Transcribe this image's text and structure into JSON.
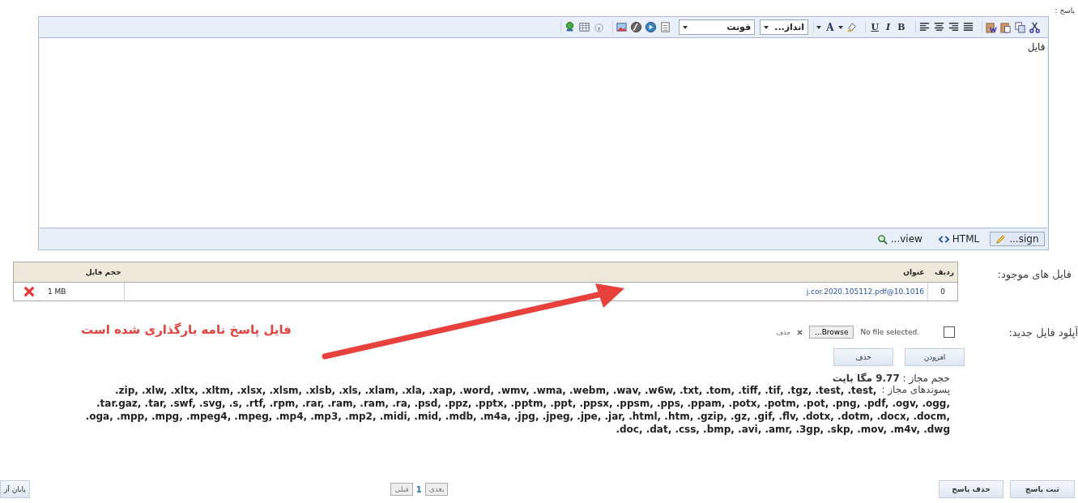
{
  "answer_label": "پاسخ :",
  "editor": {
    "format_buttons": [
      "B",
      "I",
      "U"
    ],
    "font_color_letter": "A",
    "size_select": "انداز...",
    "font_select": "فونت",
    "content": "فایل",
    "modes": [
      {
        "label": "...sign",
        "selected": true
      },
      {
        "label": "HTML",
        "selected": false
      },
      {
        "label": "...view",
        "selected": false
      }
    ]
  },
  "existing_files": {
    "label": "فایل های موجود:",
    "columns": [
      "ردیف",
      "عنوان",
      "حجم فایل"
    ],
    "rows": [
      {
        "index": "0",
        "title": "j.cor.2020.105112.pdf@10.1016",
        "size": "1 MB"
      }
    ]
  },
  "annotation": "فایل پاسخ نامه بارگذاری شده است",
  "upload": {
    "label": "آپلود فایل جدید:",
    "checked": false,
    "file_status": "No file selected.",
    "browse": "Browse...",
    "remove_link": "حذف",
    "buttons": [
      "افزودن",
      "حذف"
    ]
  },
  "allowed_size": "حجم مجاز : **9.77 مگا بایت**",
  "extensions_label": "پسوندهای مجاز :",
  "extensions_lines": [
    ".zip, .xlw, .xltx, .xltm, .xlsx, .xlsm, .xlsb, .xls, .xlam, .xla, .xap, .word, .wmv, .wma, .webm, .wav, .w6w, .txt, .tom, .tiff, .tif, .tgz, .test, .test,",
    ".tar.gaz, .tar, .swf, .svg, .s, .rtf, .rpm, .rar, .ram, .ram, .ra, .psd, .ppz, .pptx, .pptm, .ppt, .ppsx, .ppsm, .pps, .ppam, .potx, .potm, .pot, .png, .pdf, .ogv, .ogg,",
    ".oga, .mpp, .mpg, .mpeg4, .mpeg, .mp4, .mp3, .mp2, .midi, .mid, .mdb, .m4a, .jpg, .jpeg, .jpe, .jar, .html, .htm, .gzip, .gz, .gif, .flv, .dotx, .dotm, .docx, .docm,",
    ".doc, .dat, .css, .bmp, .avi, .amr, .3gp, .skp, .mov, .m4v, .dwg"
  ],
  "actions": [
    "ثبت پاسخ",
    "حذف پاسخ"
  ],
  "pager": {
    "next": "بعدی",
    "page": "1",
    "prev": "قبلی"
  },
  "finish": "پایان آز"
}
